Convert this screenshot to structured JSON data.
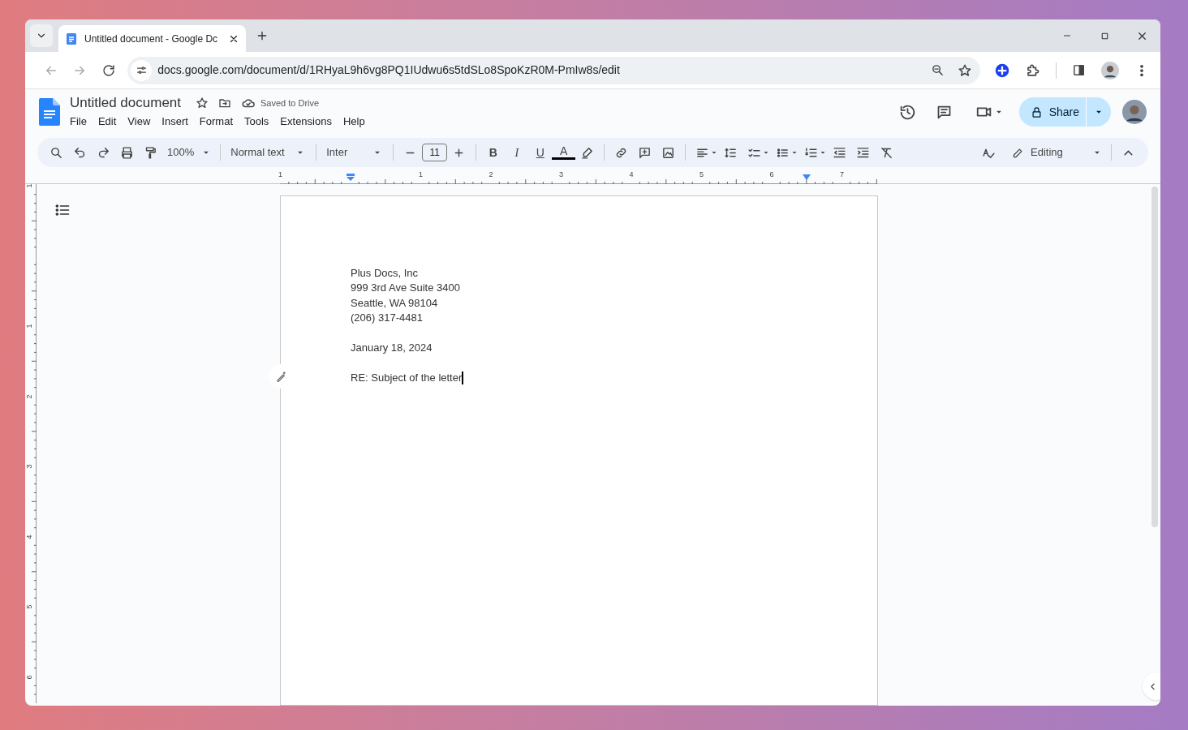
{
  "browser": {
    "tab_title": "Untitled document - Google Dc",
    "url": "docs.google.com/document/d/1RHyaL9h6vg8PQ1IUdwu6s5tdSLo8SpoKzR0M-PmIw8s/edit"
  },
  "docs": {
    "title": "Untitled document",
    "save_status": "Saved to Drive",
    "menu": [
      "File",
      "Edit",
      "View",
      "Insert",
      "Format",
      "Tools",
      "Extensions",
      "Help"
    ],
    "share_label": "Share"
  },
  "toolbar": {
    "zoom": "100%",
    "style": "Normal text",
    "font": "Inter",
    "font_size": "11",
    "format_buttons": [
      "B",
      "I",
      "U",
      "A"
    ],
    "mode": "Editing"
  },
  "ruler": {
    "horizontal_labels": [
      "1",
      "1",
      "2",
      "3",
      "4",
      "5",
      "6",
      "7"
    ],
    "vertical_labels": [
      "1",
      "1",
      "2",
      "3",
      "4",
      "5",
      "6"
    ]
  },
  "document": {
    "blocks": [
      [
        "Plus Docs, Inc",
        "999 3rd Ave Suite 3400",
        "Seattle, WA 98104",
        "(206) 317-4481"
      ],
      [
        "January 18, 2024"
      ],
      [
        "RE: Subject of the letter"
      ]
    ]
  }
}
